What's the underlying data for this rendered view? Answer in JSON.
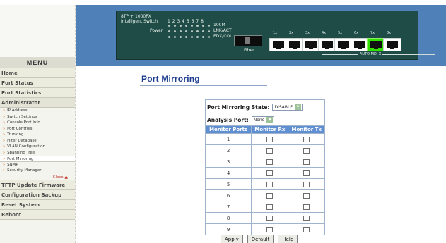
{
  "device": {
    "model_line1": "8TP + 1000FX",
    "model_line2": "Intelligent Switch",
    "led_numbers": "1 2 3 4 5 6 7 8",
    "led_100m_label": "100M",
    "power_label": "Power",
    "lnkact_label": "LNK/ACT",
    "fdxcol_label": "FDX/COL",
    "fiber_label": "Fiber",
    "port_labels": [
      "1x",
      "2x",
      "3x",
      "4x",
      "5x",
      "6x",
      "7x",
      "8x"
    ],
    "auto_mdix_label": "AUTO MDI-X",
    "active_port_color": "#32e000"
  },
  "sidebar": {
    "menu_title": "MENU",
    "items_top": [
      {
        "label": "Home"
      },
      {
        "label": "Port Status"
      },
      {
        "label": "Port Statistics"
      },
      {
        "label": "Administrator"
      }
    ],
    "admin_subitems": [
      {
        "label": "IP Address"
      },
      {
        "label": "Switch Settings"
      },
      {
        "label": "Console Port Info"
      },
      {
        "label": "Port Controls"
      },
      {
        "label": "Trunking"
      },
      {
        "label": "Filter Database"
      },
      {
        "label": "VLAN Configuration"
      },
      {
        "label": "Spanning Tree"
      },
      {
        "label": "Port Mirroring"
      },
      {
        "label": "SNMP"
      },
      {
        "label": "Security Manager"
      }
    ],
    "close_label": "Close",
    "items_bottom": [
      {
        "label": "TFTP Update Firmware"
      },
      {
        "label": "Configuration Backup"
      },
      {
        "label": "Reset System"
      },
      {
        "label": "Reboot"
      }
    ]
  },
  "main": {
    "page_title": "Port Mirroring",
    "state_label": "Port Mirroring State:",
    "state_value": "DISABLE",
    "analysis_label": "Analysis Port:",
    "analysis_value": "None",
    "table_headers": [
      "Monitor Ports",
      "Monitor Rx",
      "Monitor Tx"
    ],
    "ports": [
      "1",
      "2",
      "3",
      "4",
      "5",
      "6",
      "7",
      "8",
      "9"
    ],
    "buttons": {
      "apply": "Apply",
      "default": "Default",
      "help": "Help"
    }
  }
}
